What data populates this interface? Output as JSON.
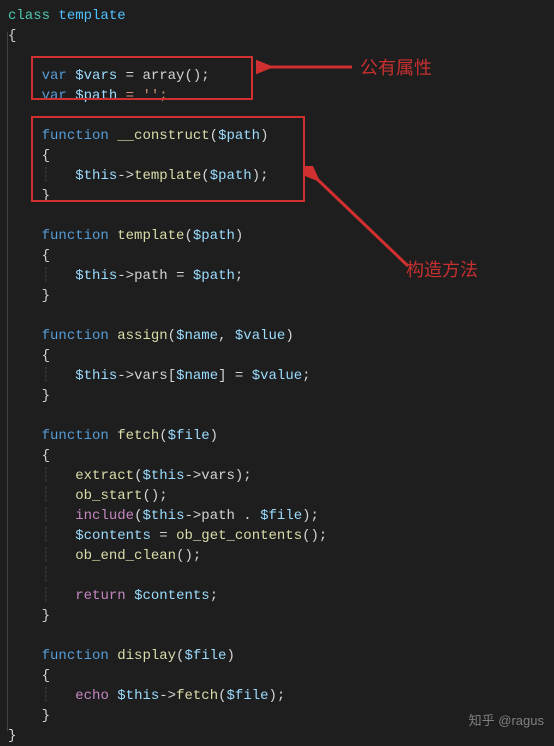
{
  "code": {
    "l1_class": "class",
    "l1_name": "template",
    "brace_open": "{",
    "brace_close": "}",
    "var_kw": "var",
    "vars_name": "$vars",
    "vars_init": " = array();",
    "path_name": "$path",
    "path_init": " = '';",
    "func_kw": "function",
    "construct_name": "__construct",
    "construct_param": "$path",
    "this_kw": "$this",
    "arrow": "->",
    "template_call": "template",
    "template_param": "$path",
    "tmpl_name": "template",
    "tmpl_param": "$path",
    "tmpl_body_prop": "path",
    "tmpl_body_val": "$path",
    "assign_name": "assign",
    "assign_p1": "$name",
    "assign_p2": "$value",
    "assign_prop": "vars",
    "fetch_name": "fetch",
    "fetch_param": "$file",
    "extract_fn": "extract",
    "obstart_fn": "ob_start",
    "include_kw": "include",
    "include_prop": "path",
    "contents_var": "$contents",
    "obget_fn": "ob_get_contents",
    "obend_fn": "ob_end_clean",
    "return_kw": "return",
    "display_name": "display",
    "display_param": "$file",
    "echo_kw": "echo",
    "fetch_call": "fetch"
  },
  "labels": {
    "public_prop": "公有属性",
    "constructor": "构造方法"
  },
  "watermark": "知乎 @ragus"
}
